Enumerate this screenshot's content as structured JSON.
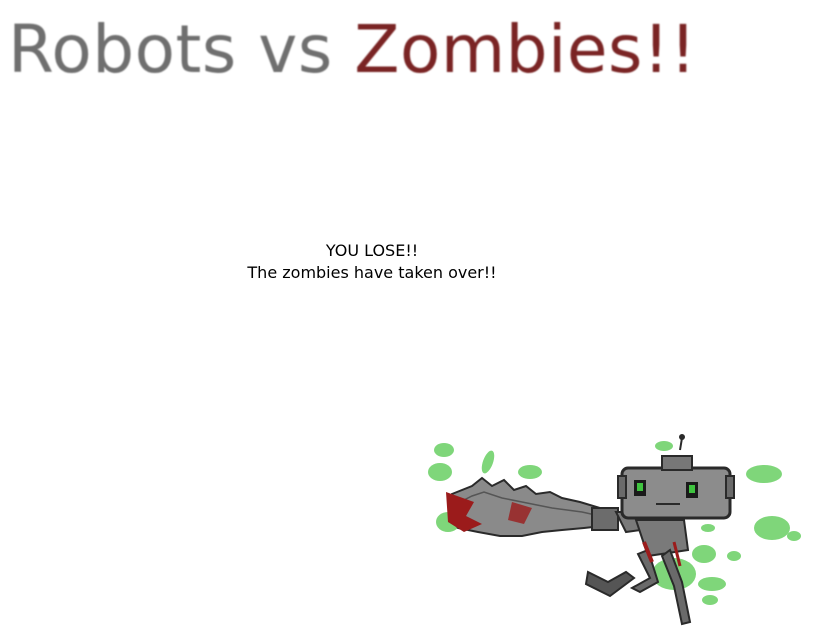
{
  "logo": {
    "robots_text": "Robots vs",
    "zombies_text": "Zombies!!"
  },
  "game_over": {
    "headline": "YOU LOSE!!",
    "subtext": "The zombies have taken over!!"
  },
  "art": {
    "name": "chainsaw-robot-illustration",
    "colors": {
      "splatter": "#7fd67a",
      "blood": "#9b1b1b",
      "metal": "#8c8c8c",
      "eye": "#3fc43f"
    }
  }
}
